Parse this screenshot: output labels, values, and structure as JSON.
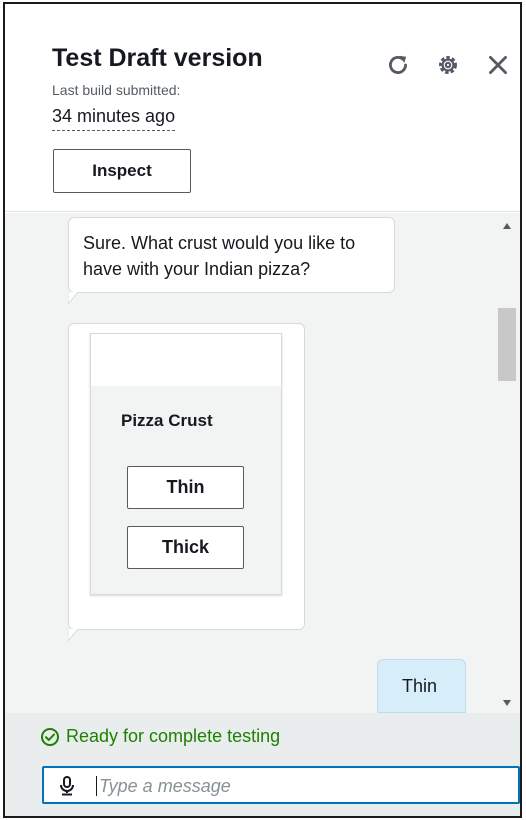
{
  "header": {
    "title": "Test Draft version",
    "subtitle": "Last build submitted:",
    "time_ago": "34 minutes ago",
    "inspect_label": "Inspect",
    "icons": [
      "refresh-icon",
      "gear-icon",
      "close-icon"
    ]
  },
  "chat": {
    "messages": [
      {
        "sender": "bot",
        "text": "Sure. What crust would you like to have with your Indian pizza?"
      },
      {
        "sender": "bot",
        "card": {
          "title": "Pizza Crust",
          "buttons": [
            "Thin",
            "Thick"
          ]
        }
      },
      {
        "sender": "user",
        "text": "Thin"
      }
    ]
  },
  "footer": {
    "status_text": "Ready for complete testing",
    "input_placeholder": "Type a message",
    "input_value": ""
  },
  "colors": {
    "accent": "#0073bb",
    "success": "#1d8102",
    "user_bubble": "#d7edf9",
    "panel_bg": "#f2f3f3"
  }
}
